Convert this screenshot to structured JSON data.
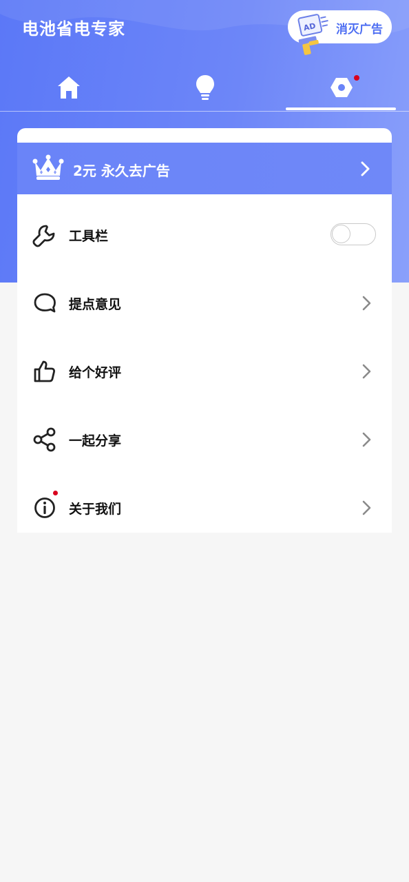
{
  "header": {
    "app_title": "电池省电专家",
    "remove_ads_label": "消灭广告",
    "ad_icon_text": "AD",
    "tabs": [
      {
        "name": "home",
        "icon": "home-icon",
        "selected": false
      },
      {
        "name": "tips",
        "icon": "lightbulb-icon",
        "selected": false
      },
      {
        "name": "settings",
        "icon": "settings-icon",
        "selected": true,
        "badge": true
      }
    ]
  },
  "premium": {
    "label": "2元 永久去广告",
    "icon": "crown-icon"
  },
  "settings": {
    "items": [
      {
        "label": "工具栏",
        "icon": "wrench-icon",
        "control": "toggle",
        "toggle_on": false
      },
      {
        "label": "提点意见",
        "icon": "speech-bubble-icon",
        "control": "chevron"
      },
      {
        "label": "给个好评",
        "icon": "thumbs-up-icon",
        "control": "chevron"
      },
      {
        "label": "一起分享",
        "icon": "share-icon",
        "control": "chevron"
      },
      {
        "label": "关于我们",
        "icon": "info-icon",
        "control": "chevron",
        "badge": true
      }
    ]
  },
  "colors": {
    "header_start": "#5b78f7",
    "header_end": "#8aa0fb",
    "accent_text": "#4d6ef2",
    "badge": "#d8001e",
    "background": "#f6f6f6"
  }
}
